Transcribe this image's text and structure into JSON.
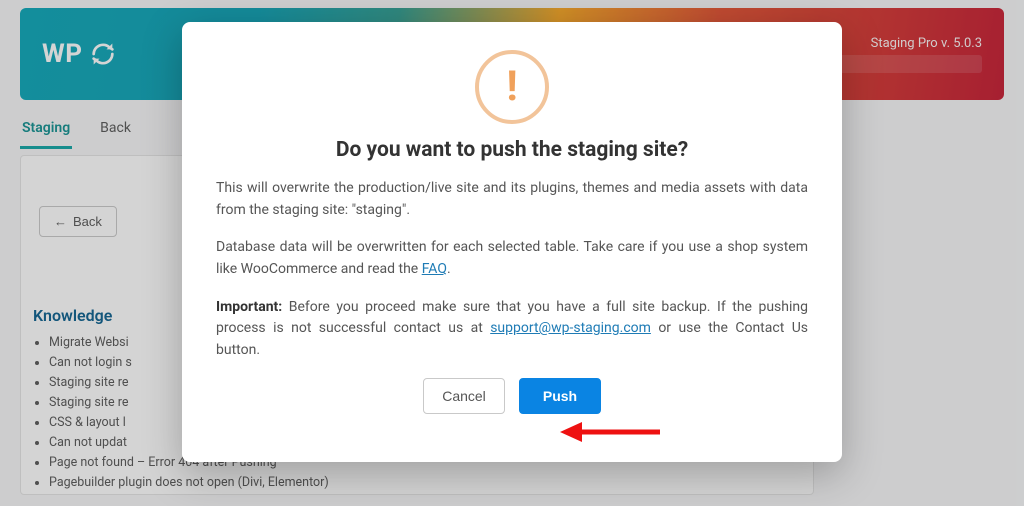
{
  "header": {
    "brand_prefix": "WP",
    "version_label": "Staging Pro v. 5.0.3"
  },
  "tabs": {
    "active": "Staging",
    "second": "Back"
  },
  "back_button": "Back",
  "kb": {
    "title": "Knowledge",
    "items": [
      "Migrate Websi",
      "Can not login s",
      "Staging site re",
      "Staging site re",
      "CSS & layout l",
      "Can not updat",
      "Page not found – Error 404 after Pushing",
      "Pagebuilder plugin does not open (Divi, Elementor)"
    ]
  },
  "modal": {
    "title": "Do you want to push the staging site?",
    "p1": "This will overwrite the production/live site and its plugins, themes and media assets with data from the staging site: \"staging\".",
    "p2_a": "Database data will be overwritten for each selected table. Take care if you use a shop system like WooCommerce and read the ",
    "p2_link": "FAQ",
    "p2_b": ".",
    "p3_strong": "Important:",
    "p3_a": " Before you proceed make sure that you have a full site backup. If the pushing process is not successful contact us at ",
    "p3_link": "support@wp-staging.com",
    "p3_b": " or use the Contact Us button.",
    "cancel": "Cancel",
    "push": "Push"
  }
}
